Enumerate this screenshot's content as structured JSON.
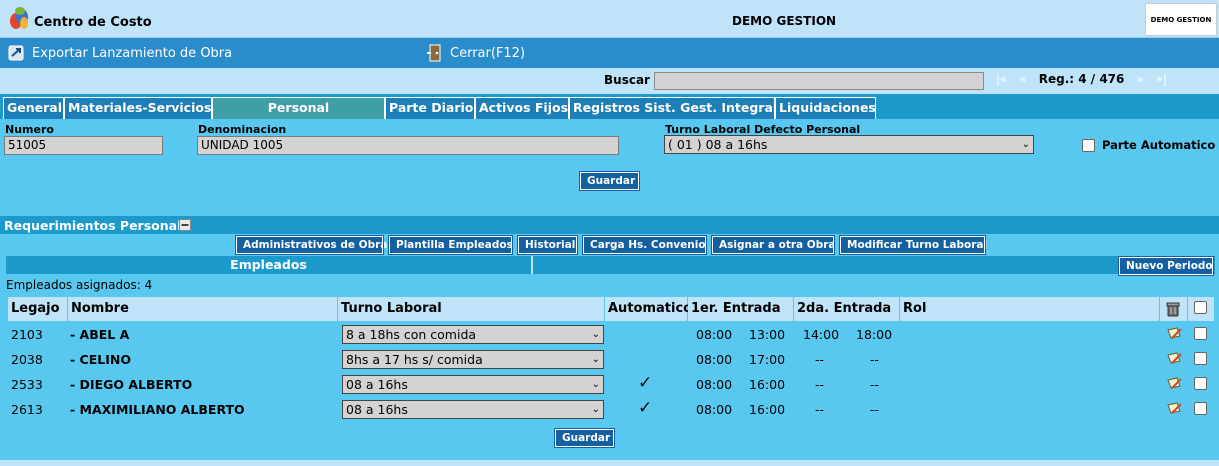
{
  "header": {
    "app_title": "Centro de Costo",
    "center_title": "DEMO GESTION",
    "brand_text": "DEMO GESTION"
  },
  "toolbar": {
    "export_label": "Exportar Lanzamiento de Obra",
    "close_label": "Cerrar(F12)"
  },
  "search": {
    "label": "Buscar",
    "value": "",
    "first": "|«",
    "prev": "«",
    "reg": "Reg.: 4 / 476",
    "next": "»",
    "last": "»|"
  },
  "tabs": [
    {
      "label": "General"
    },
    {
      "label": "Materiales-Servicios"
    },
    {
      "label": "Personal"
    },
    {
      "label": "Parte Diario"
    },
    {
      "label": "Activos Fijos"
    },
    {
      "label": "Registros Sist. Gest. Integral"
    },
    {
      "label": "Liquidaciones"
    }
  ],
  "form": {
    "numero_label": "Numero",
    "numero_value": "51005",
    "denominacion_label": "Denominacion",
    "denominacion_value": "UNIDAD 1005",
    "turno_label": "Turno Laboral Defecto Personal",
    "turno_value": "( 01 ) 08 a 16hs",
    "parte_auto_label": "Parte Automatico",
    "guardar": "Guardar"
  },
  "requerimientos": {
    "title": "Requerimientos Personal",
    "buttons": [
      "Administrativos de Obra",
      "Plantilla Empleados",
      "Historial",
      "Carga Hs. Convenio",
      "Asignar a otra Obra",
      "Modificar Turno Laboral"
    ],
    "empleados_title": "Empleados",
    "nuevo_periodo": "Nuevo Periodo",
    "asignados": "Empleados asignados: 4"
  },
  "table": {
    "headers": {
      "legajo": "Legajo",
      "nombre": "Nombre",
      "turno": "Turno Laboral",
      "automatico": "Automatico",
      "entrada1": "1er. Entrada",
      "entrada2": "2da. Entrada",
      "rol": "Rol"
    },
    "rows": [
      {
        "legajo": "2103",
        "nombre": "- ABEL A",
        "turno": "8 a 18hs con comida",
        "automatico": "",
        "e1_in": "08:00",
        "e1_out": "13:00",
        "e2_in": "14:00",
        "e2_out": "18:00"
      },
      {
        "legajo": "2038",
        "nombre": "- CELINO",
        "turno": "8hs a 17 hs s/ comida",
        "automatico": "",
        "e1_in": "08:00",
        "e1_out": "17:00",
        "e2_in": "--",
        "e2_out": "--"
      },
      {
        "legajo": "2533",
        "nombre": "- DIEGO ALBERTO",
        "turno": "08 a 16hs",
        "automatico": "✓",
        "e1_in": "08:00",
        "e1_out": "16:00",
        "e2_in": "--",
        "e2_out": "--"
      },
      {
        "legajo": "2613",
        "nombre": "- MAXIMILIANO ALBERTO",
        "turno": "08 a 16hs",
        "automatico": "✓",
        "e1_in": "08:00",
        "e1_out": "16:00",
        "e2_in": "--",
        "e2_out": "--"
      }
    ],
    "guardar": "Guardar"
  },
  "icons": {
    "logo": "centro-de-costo-logo-icon",
    "export": "export-icon",
    "close": "door-exit-icon",
    "collapse": "collapse-minus-icon",
    "trash": "trash-bin-icon",
    "edit": "pencil-note-icon",
    "dropdown": "chevron-down-icon"
  },
  "colors": {
    "panel_bg": "#58C8F0",
    "header_bg": "#BFE3F9",
    "toolbar_bg": "#2B8CCB",
    "tab_bg": "#1E7FB8",
    "tab_active_bg": "#3F9FA6",
    "button_bg": "#1460A0"
  }
}
